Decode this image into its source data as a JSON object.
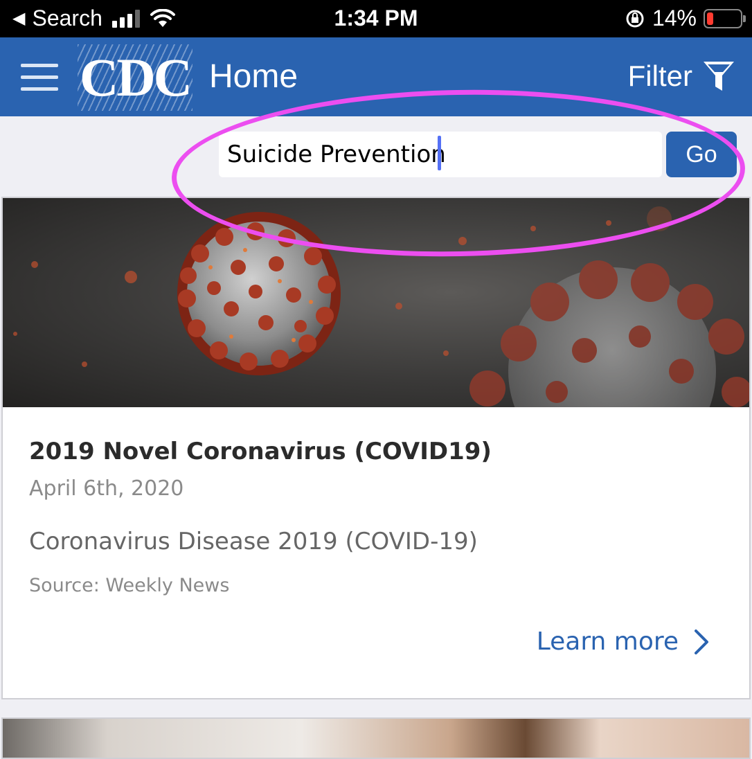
{
  "status_bar": {
    "back_label": "Search",
    "time": "1:34 PM",
    "battery": "14%",
    "battery_level": 0.14
  },
  "header": {
    "logo": "CDC",
    "title": "Home",
    "filter_label": "Filter"
  },
  "search": {
    "value": "Suicide Prevention",
    "go_label": "Go"
  },
  "card": {
    "title": "2019 Novel Coronavirus (COVID19)",
    "date": "April 6th, 2020",
    "description": "Coronavirus Disease 2019 (COVID-19)",
    "source": "Source: Weekly News",
    "link_label": "Learn more"
  },
  "colors": {
    "header_bg": "#2a63b0",
    "highlight": "#ec4ef0",
    "link": "#2a63b0"
  }
}
